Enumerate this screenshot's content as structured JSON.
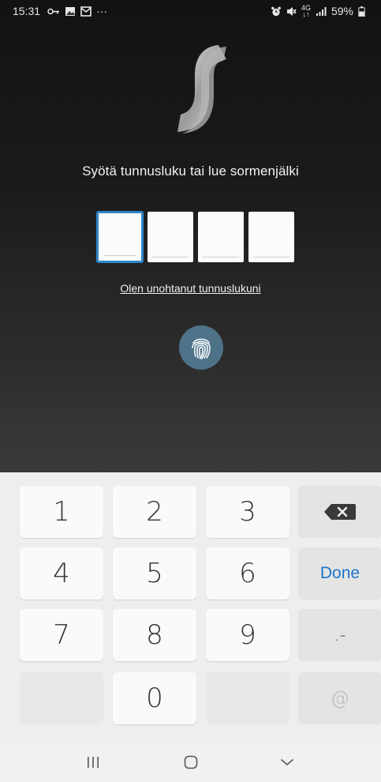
{
  "status_bar": {
    "time": "15:31",
    "more_indicator": "···",
    "network_label": "4G",
    "battery": "59%"
  },
  "auth": {
    "prompt": "Syötä tunnusluku tai lue sormenjälki",
    "pin_length": 4,
    "pin_values": [
      "",
      "",
      "",
      ""
    ],
    "forgot_link": "Olen unohtanut tunnuslukuni"
  },
  "keypad": {
    "keys": [
      "1",
      "2",
      "3",
      "4",
      "5",
      "6",
      "7",
      "8",
      "9",
      "0"
    ],
    "done_label": "Done",
    "symbols_label": ".-",
    "at_label": "@"
  },
  "colors": {
    "accent": "#2f86c9",
    "done_text": "#1b73c9",
    "fingerprint_button": "#4e7389"
  },
  "icons": {
    "fingerprint": "fingerprint-icon",
    "backspace": "backspace-icon",
    "logo": "s-logo"
  }
}
